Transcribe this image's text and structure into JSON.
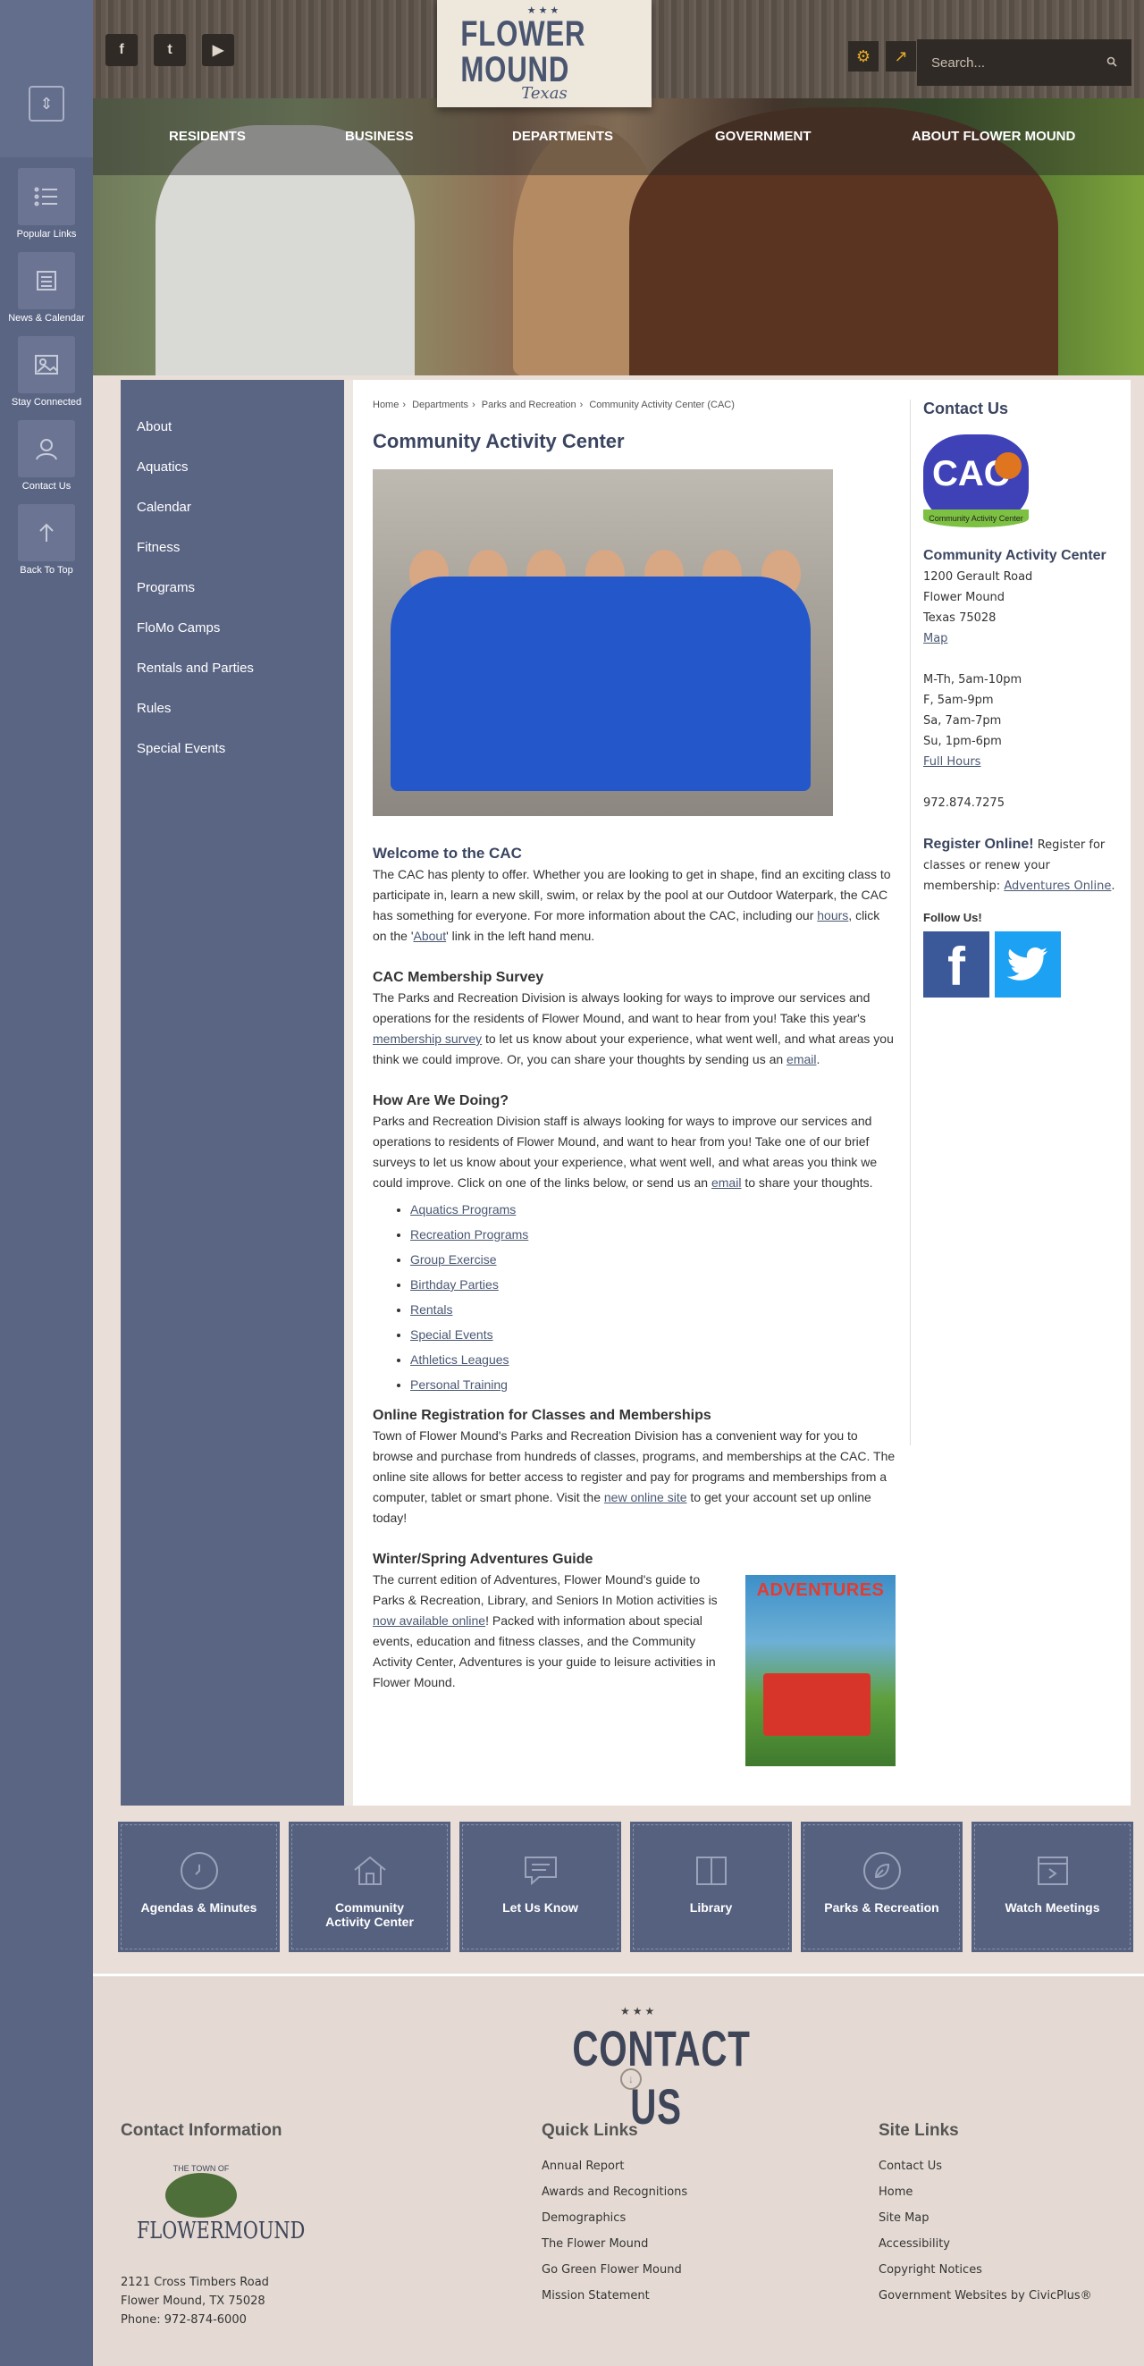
{
  "rail": {
    "items": [
      {
        "label": "Popular Links"
      },
      {
        "label": "News & Calendar"
      },
      {
        "label": "Stay Connected"
      },
      {
        "label": "Contact Us"
      },
      {
        "label": "Back To Top"
      }
    ]
  },
  "header": {
    "logo_name": "FLOWER MOUND",
    "logo_sub": "Texas",
    "logo_stars": "★★★",
    "search_placeholder": "Search...",
    "social": [
      "f",
      "t",
      "▶"
    ],
    "nav": [
      "RESIDENTS",
      "BUSINESS",
      "DEPARTMENTS",
      "GOVERNMENT",
      "ABOUT FLOWER MOUND"
    ]
  },
  "sidebar": {
    "items": [
      "About",
      "Aquatics",
      "Calendar",
      "Fitness",
      "Programs",
      "FloMo Camps",
      "Rentals and Parties",
      "Rules",
      "Special Events"
    ]
  },
  "breadcrumb": {
    "home": "Home",
    "departments": "Departments",
    "parks": "Parks and Recreation",
    "current": "Community Activity Center (CAC)"
  },
  "page": {
    "title": "Community Activity Center",
    "welcome": {
      "heading": "Welcome to the CAC",
      "p1": "The CAC has plenty to offer. Whether you are looking to get in shape, find an exciting class to participate in, learn a new skill, swim, or relax by the pool at our Outdoor Waterpark, the CAC has something for everyone. For more information about the CAC, including our ",
      "link_hours": "hours",
      "p2": ", click on the '",
      "link_about": "About",
      "p3": "' link in the left hand menu."
    },
    "survey": {
      "heading": "CAC Membership Survey",
      "p1": "The Parks and Recreation Division is always looking for ways to improve our services and operations for the residents of Flower Mound, and want to hear from you! Take this year's ",
      "link_survey": "membership survey",
      "p2": " to let us know about your experience, what went well, and what areas you think we could improve. Or, you can share your thoughts by sending us an ",
      "link_email": "email",
      "p3": "."
    },
    "doing": {
      "heading": "How Are We Doing?",
      "p1": "Parks and Recreation Division staff is always looking for ways to improve our services and operations to residents of Flower Mound, and want to hear from you! Take one of our brief surveys to let us know about your experience, what went well, and what areas you think we could improve. Click on one of the links below, or send us an ",
      "link_email": "email",
      "p2": " to share your thoughts.",
      "links": [
        "Aquatics Programs",
        "Recreation Programs",
        "Group Exercise",
        "Birthday Parties",
        "Rentals",
        "Special Events",
        "Athletics Leagues",
        "Personal Training"
      ]
    },
    "registration": {
      "heading": "Online Registration for Classes and Memberships",
      "p1": "Town of Flower Mound's Parks and Recreation Division has a convenient way for you to browse and purchase from hundreds of classes, programs, and memberships at the CAC. The online site allows for better access to register and pay for programs and memberships from a computer, tablet or smart phone. Visit the ",
      "link": "new online site",
      "p2": " to get your account set up online today!"
    },
    "guide": {
      "heading": "Winter/Spring Adventures Guide",
      "p1": "The current edition of Adventures, Flower Mound's guide to Parks & Recreation, Library, and Seniors In Motion activities is ",
      "link": "now available online",
      "p2": "! Packed with information about special events, education and fitness classes, and the Community Activity Center, Adventures is your guide to leisure activities in Flower Mound.",
      "cover_title": "ADVENTURES"
    }
  },
  "contact": {
    "heading": "Contact Us",
    "logo_text": "CAC",
    "logo_band": "Community Activity Center",
    "name": "Community Activity Center",
    "street": "1200 Gerault Road",
    "city": "Flower Mound",
    "state_zip": "Texas 75028",
    "map": "Map",
    "hours": [
      "M-Th, 5am-10pm",
      "F, 5am-9pm",
      "Sa, 7am-7pm",
      "Su, 1pm-6pm"
    ],
    "full_hours": "Full Hours",
    "phone": "972.874.7275",
    "register_heading": "Register Online!",
    "register_text": " Register for classes or renew your membership: ",
    "register_link": "Adventures Online",
    "follow": "Follow Us!"
  },
  "tiles": [
    "Agendas & Minutes",
    "Community Activity Center",
    "Let Us Know",
    "Library",
    "Parks & Recreation",
    "Watch Meetings"
  ],
  "footer": {
    "title": "CONTACT US",
    "contact_heading": "Contact Information",
    "town_small": "THE TOWN OF",
    "town_name": "FLOWERMOUND",
    "address1": "2121 Cross Timbers Road",
    "address2": "Flower Mound, TX 75028",
    "phone": "Phone: 972-874-6000",
    "quick_heading": "Quick Links",
    "quick": [
      "Annual Report",
      "Awards and Recognitions",
      "Demographics",
      "The Flower Mound",
      "Go Green Flower Mound",
      "Mission Statement"
    ],
    "site_heading": "Site Links",
    "site": [
      "Contact Us",
      "Home",
      "Site Map",
      "Accessibility",
      "Copyright Notices",
      "Government Websites by CivicPlus®"
    ]
  },
  "colors": {
    "rail": "#5a6584",
    "accent_text": "#3b4560",
    "footer_bg": "#e4dad3"
  }
}
